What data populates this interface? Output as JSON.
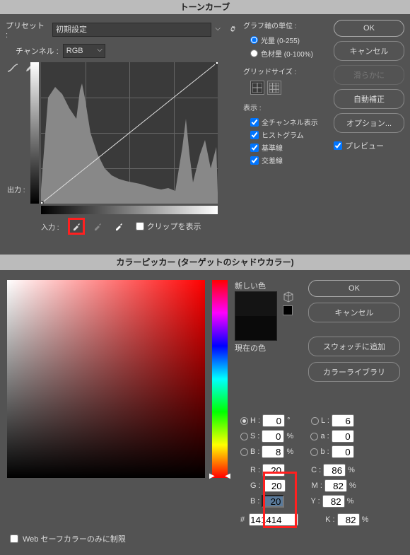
{
  "curves": {
    "title": "トーンカーブ",
    "preset_lbl": "プリセット :",
    "preset_value": "初期設定",
    "channel_lbl": "チャンネル :",
    "channel_value": "RGB",
    "output_lbl": "出力 :",
    "input_lbl": "入力 :",
    "clip_lbl": "クリップを表示",
    "axis_lbl": "グラフ軸の単位 :",
    "axis_opt1": "光量 (0-255)",
    "axis_opt2": "色材量 (0-100%)",
    "grid_lbl": "グリッドサイズ :",
    "display_lbl": "表示 :",
    "chk_all_channels": "全チャンネル表示",
    "chk_histogram": "ヒストグラム",
    "chk_baseline": "基準線",
    "chk_intersection": "交差線",
    "chk_preview": "プレビュー",
    "btn_ok": "OK",
    "btn_cancel": "キャンセル",
    "btn_smooth": "滑らかに",
    "btn_auto": "自動補正",
    "btn_options": "オプション..."
  },
  "picker": {
    "title": "カラーピッカー (ターゲットのシャドウカラー)",
    "new_lbl": "新しい色",
    "current_lbl": "現在の色",
    "btn_ok": "OK",
    "btn_cancel": "キャンセル",
    "btn_add_swatch": "スウォッチに追加",
    "btn_libraries": "カラーライブラリ",
    "h_lbl": "H :",
    "h_val": "0",
    "h_unit": "°",
    "s_lbl": "S :",
    "s_val": "0",
    "s_unit": "%",
    "br_lbl": "B :",
    "br_val": "8",
    "br_unit": "%",
    "r_lbl": "R :",
    "r_val": "20",
    "g_lbl": "G :",
    "g_val": "20",
    "b_lbl": "B :",
    "b_val": "20",
    "l_lbl": "L :",
    "l_val": "6",
    "a_lbl": "a :",
    "a_val": "0",
    "lab_b_lbl": "b :",
    "lab_b_val": "0",
    "c_lbl": "C :",
    "c_val": "86",
    "pct": "%",
    "m_lbl": "M :",
    "m_val": "82",
    "y_lbl": "Y :",
    "y_val": "82",
    "k_lbl": "K :",
    "k_val": "82",
    "hex_lbl": "#",
    "hex_val": "141414",
    "websafe_lbl": "Web セーフカラーのみに制限"
  }
}
